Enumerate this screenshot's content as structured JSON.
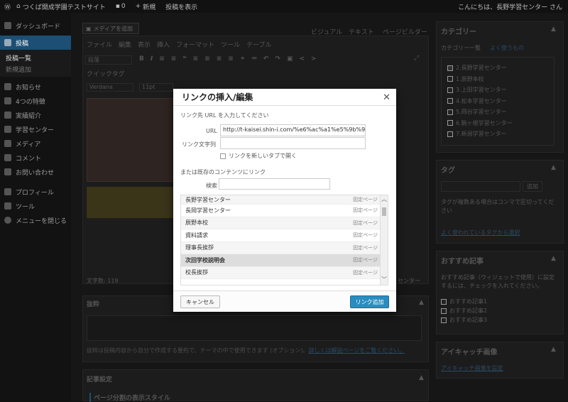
{
  "adminbar": {
    "site": "つくば開成学園テストサイト",
    "comments": "0",
    "new": "新規",
    "view": "投稿を表示",
    "greeting": "こんにちは、長野学習センター さん"
  },
  "sidebar": {
    "items": [
      {
        "label": "ダッシュボード",
        "icon": "dashboard-icon"
      },
      {
        "label": "投稿",
        "icon": "pin-icon",
        "active": true
      },
      {
        "label": "お知らせ",
        "icon": "pin-icon"
      },
      {
        "label": "4つの特徴",
        "icon": "pin-icon"
      },
      {
        "label": "実績紹介",
        "icon": "pin-icon"
      },
      {
        "label": "学習センター",
        "icon": "pin-icon"
      },
      {
        "label": "メディア",
        "icon": "media-icon"
      },
      {
        "label": "コメント",
        "icon": "comment-icon"
      },
      {
        "label": "お問い合わせ",
        "icon": "mail-icon"
      },
      {
        "label": "プロフィール",
        "icon": "user-icon"
      },
      {
        "label": "ツール",
        "icon": "tools-icon"
      },
      {
        "label": "メニューを閉じる",
        "icon": "collapse-icon"
      }
    ],
    "sub": [
      "投稿一覧",
      "新規追加"
    ]
  },
  "editor": {
    "add_media": "メディアを追加",
    "tab_visual": "ビジュアル",
    "tab_text": "テキスト",
    "tab_builder": "ページビルダー",
    "menus": [
      "ファイル",
      "編集",
      "表示",
      "挿入",
      "フォーマット",
      "ツール",
      "テーブル"
    ],
    "format": "段落",
    "quick_tag": "クイックタグ",
    "font": "Verdana",
    "size": "11pt",
    "word_count": "文字数: 119",
    "center_tag": "センター"
  },
  "excerpt": {
    "title": "抜粋",
    "help": "抜粋は投稿内容から自分で作成する要約で、テーマの中で使用できます (オプション)。",
    "link": "詳しくは解説ページをご覧ください。"
  },
  "settings": {
    "title": "記事設定",
    "sub": "ページ分割の表示スタイル"
  },
  "categories": {
    "title": "カテゴリー",
    "tab_all": "カテゴリー一覧",
    "tab_pop": "よく使うもの",
    "items": [
      "2.長野学習センター",
      "1.辰野本校",
      "3.上田学習センター",
      "4.松本学習センター",
      "5.岡谷学習センター",
      "6.駒ヶ根学習センター",
      "7.新潟学習センター"
    ]
  },
  "tags": {
    "title": "タグ",
    "add": "追加",
    "hint": "タグが複数ある場合はコンマで区切ってください",
    "link": "よく使われているタグから選択"
  },
  "recommend": {
    "title": "おすすめ記事",
    "desc": "おすすめ記事（ウィジェットで使用）に設定するには、チェックを入れてください。",
    "items": [
      "おすすめ記事1",
      "おすすめ記事2",
      "おすすめ記事3"
    ]
  },
  "eyecatch": {
    "title": "アイキャッチ画像",
    "link": "アイキャッチ画像を設定"
  },
  "modal": {
    "title": "リンクの挿入/編集",
    "intro": "リンク先 URL を入力してください",
    "url_label": "URL",
    "url_value": "http://t-kaisei.shin-i.com/%e6%ac%a1%e5%9b%9e",
    "text_label": "リンク文字列",
    "text_value": "",
    "newtab": "リンクを新しいタブで開く",
    "or": "または既存のコンテンツにリンク",
    "search_label": "検索",
    "search_value": "",
    "results": [
      {
        "title": "長野学習センター",
        "type": "固定ページ"
      },
      {
        "title": "長岡学習センター",
        "type": "固定ページ"
      },
      {
        "title": "辰野本校",
        "type": "固定ページ"
      },
      {
        "title": "資料請求",
        "type": "固定ページ"
      },
      {
        "title": "理事長挨拶",
        "type": "固定ページ"
      },
      {
        "title": "次回学校説明会",
        "type": "固定ページ",
        "selected": true
      },
      {
        "title": "校長挨拶",
        "type": "固定ページ"
      }
    ],
    "cancel": "キャンセル",
    "submit": "リンク追加"
  },
  "colors": {
    "accent": "#2a8dc0",
    "menu_active": "#1c4f73",
    "link": "#2e6da4"
  }
}
